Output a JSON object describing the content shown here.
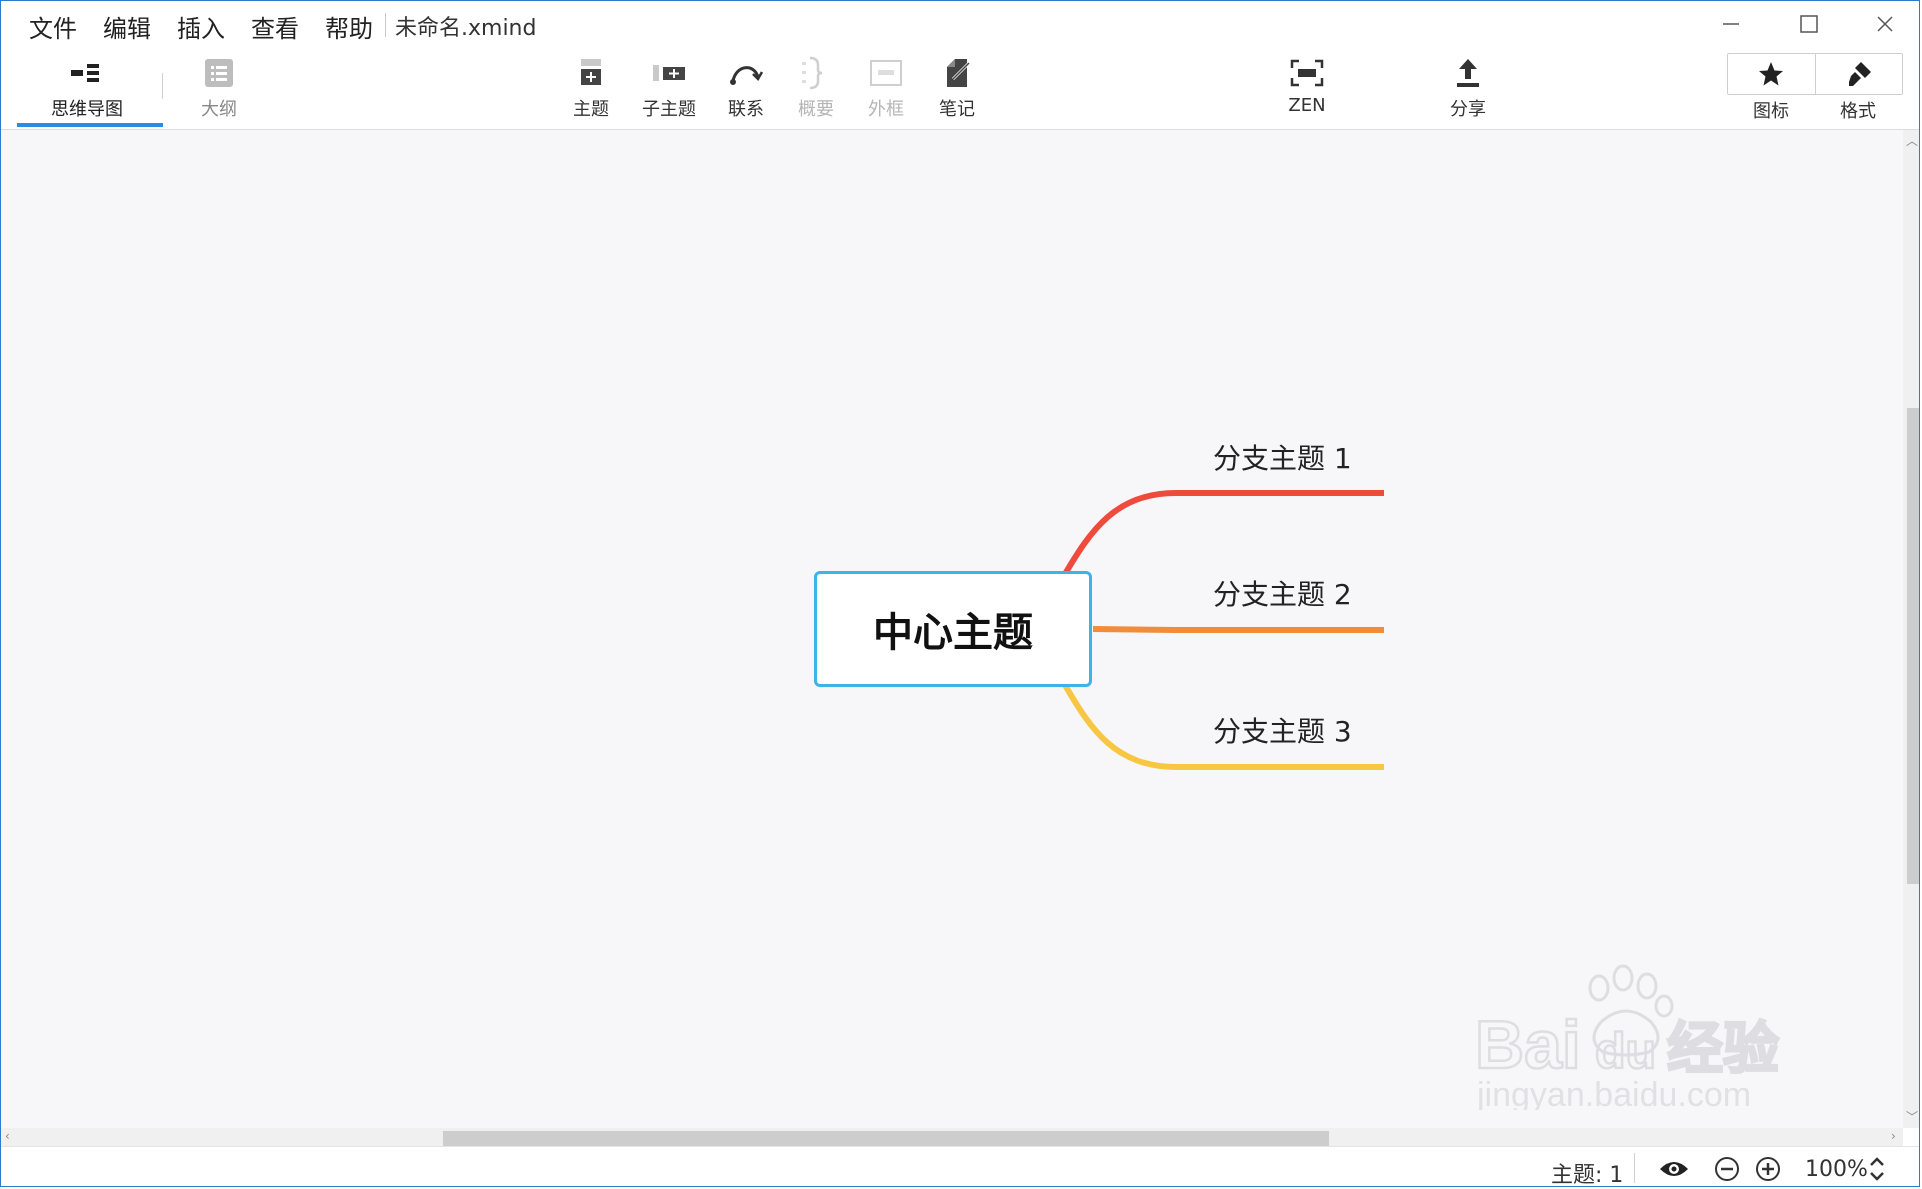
{
  "menu": {
    "items": [
      "文件",
      "编辑",
      "插入",
      "查看",
      "帮助"
    ]
  },
  "window": {
    "title": "未命名.xmind"
  },
  "view_tabs": {
    "mindmap": "思维导图",
    "outline": "大纲"
  },
  "toolbar": {
    "topic": "主题",
    "subtopic": "子主题",
    "relationship": "联系",
    "summary": "概要",
    "boundary": "外框",
    "notes": "笔记",
    "zen": "ZEN",
    "share": "分享",
    "icon": "图标",
    "format": "格式"
  },
  "map": {
    "central_topic": "中心主题",
    "branches": [
      {
        "label": "分支主题 1",
        "color": "#ee4b3c"
      },
      {
        "label": "分支主题 2",
        "color": "#f08c3a"
      },
      {
        "label": "分支主题 3",
        "color": "#f7c744"
      }
    ],
    "central_border_color": "#3db3e8"
  },
  "watermark": {
    "brand": "Bai",
    "brand2": "du",
    "brand_cn": "经验",
    "url": "jingyan.baidu.com"
  },
  "status": {
    "topic_count": "主题: 1",
    "zoom": "100%"
  }
}
